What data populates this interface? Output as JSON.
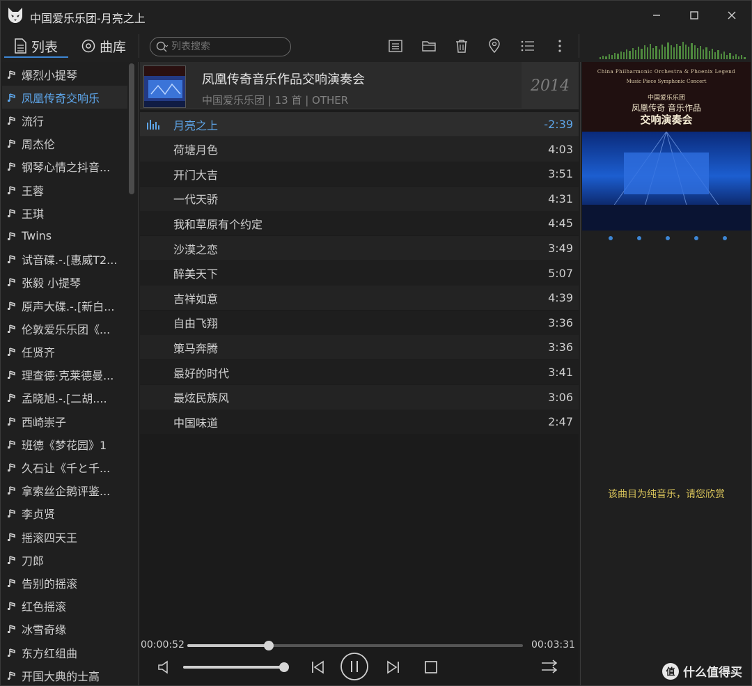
{
  "window": {
    "title": "中国爱乐乐团-月亮之上"
  },
  "tabs": [
    {
      "label": "列表",
      "active": true
    },
    {
      "label": "曲库",
      "active": false
    }
  ],
  "search": {
    "placeholder": "列表搜索"
  },
  "sidebar": {
    "items": [
      "爆烈小提琴",
      "凤凰传奇交响乐",
      "流行",
      "周杰伦",
      "钢琴心情之抖音...",
      "王蓉",
      "王琪",
      "Twins",
      "试音碟.-.[惠威T2...",
      "张毅 小提琴",
      "原声大碟.-.[新白...",
      "伦敦爱乐乐团《...",
      "任贤齐",
      "理查德·克莱德曼...",
      "孟晓旭.-.[二胡....",
      "西崎崇子",
      "班德《梦花园》1",
      "久石让《千と千...",
      "拿索丝企鹅评鉴...",
      "李贞贤",
      "摇滚四天王",
      "刀郎",
      "告别的摇滚",
      "红色摇滚",
      "冰雪奇缘",
      "东方红组曲",
      "开国大典的士高"
    ],
    "active_index": 1
  },
  "album": {
    "title": "凤凰传奇音乐作品交响演奏会",
    "meta": "中国爱乐乐团 | 13 首 | OTHER",
    "year": "2014"
  },
  "tracks": [
    {
      "name": "月亮之上",
      "duration": "-2:39",
      "playing": true
    },
    {
      "name": "荷塘月色",
      "duration": "4:03"
    },
    {
      "name": "开门大吉",
      "duration": "3:51"
    },
    {
      "name": "一代天骄",
      "duration": "4:31"
    },
    {
      "name": "我和草原有个约定",
      "duration": "4:45"
    },
    {
      "name": "沙漠之恋",
      "duration": "3:49"
    },
    {
      "name": "醉美天下",
      "duration": "5:07"
    },
    {
      "name": "吉祥如意",
      "duration": "4:39"
    },
    {
      "name": "自由飞翔",
      "duration": "3:36"
    },
    {
      "name": "策马奔腾",
      "duration": "3:36"
    },
    {
      "name": "最好的时代",
      "duration": "3:41"
    },
    {
      "name": "最炫民族风",
      "duration": "3:06"
    },
    {
      "name": "中国味道",
      "duration": "2:47"
    }
  ],
  "player": {
    "elapsed": "00:00:52",
    "total": "00:03:31",
    "progress": 0.243,
    "volume": 1.0,
    "state": "playing"
  },
  "cover": {
    "line1": "China Philharmonic Orchestra & Phoenix Legend",
    "line2": "Music Piece Symphonic Concert",
    "line3": "中国爱乐乐团",
    "line4": "凤凰传奇 音乐作品",
    "line5": "交响演奏会"
  },
  "lyrics": {
    "note": "该曲目为纯音乐，请您欣赏"
  },
  "watermark": {
    "badge": "值",
    "text": "什么值得买"
  },
  "colors": {
    "accent": "#3d86d4",
    "playing_text": "#5ea6ea",
    "lyric_note": "#d8c35a"
  }
}
